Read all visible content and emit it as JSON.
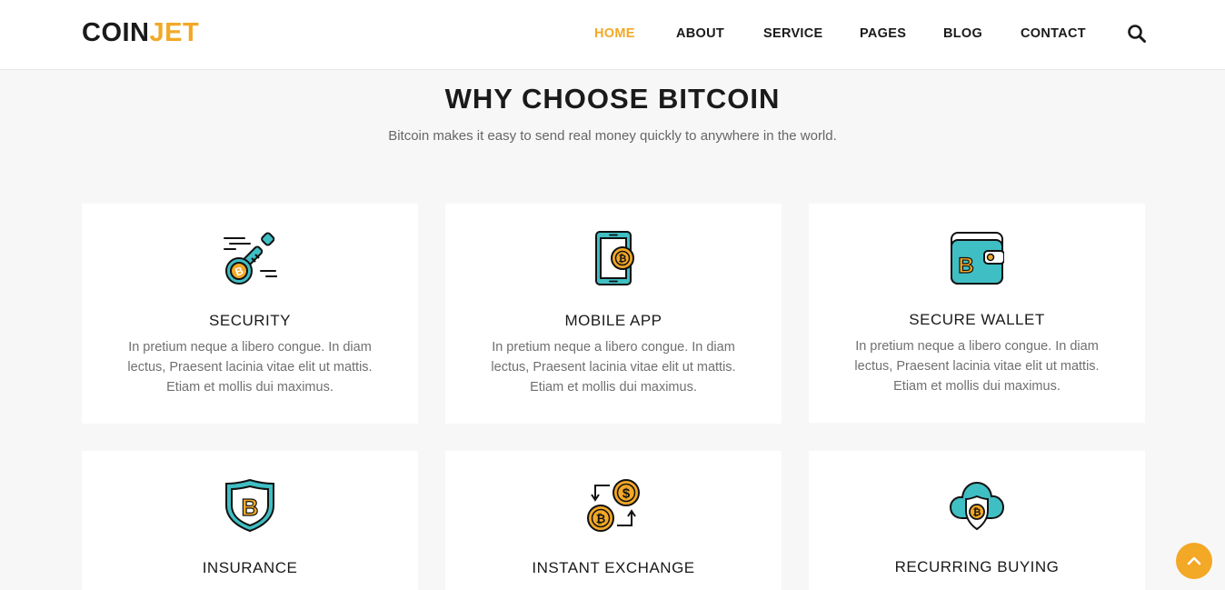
{
  "brand": {
    "part1": "COIN",
    "part2": "JET"
  },
  "nav": [
    {
      "label": "HOME",
      "active": true
    },
    {
      "label": "ABOUT"
    },
    {
      "label": "SERVICE"
    },
    {
      "label": "PAGES"
    },
    {
      "label": "BLOG"
    },
    {
      "label": "CONTACT"
    }
  ],
  "section": {
    "title": "WHY CHOOSE BITCOIN",
    "subtitle": "Bitcoin makes it easy to send real money quickly to anywhere in the world."
  },
  "features": [
    {
      "title": "SECURITY",
      "icon": "bitcoin-key-icon",
      "desc": "In pretium neque a libero congue. In diam lectus, Praesent lacinia vitae elit ut mattis. Etiam et mollis dui maximus."
    },
    {
      "title": "MOBILE APP",
      "icon": "bitcoin-phone-icon",
      "desc": "In pretium neque a libero congue. In diam lectus, Praesent lacinia vitae elit ut mattis. Etiam et mollis dui maximus."
    },
    {
      "title": "SECURE WALLET",
      "icon": "bitcoin-wallet-icon",
      "desc": "In pretium neque a libero congue. In diam lectus, Praesent lacinia vitae elit ut mattis. Etiam et mollis dui maximus."
    },
    {
      "title": "INSURANCE",
      "icon": "bitcoin-shield-icon"
    },
    {
      "title": "INSTANT EXCHANGE",
      "icon": "currency-exchange-icon"
    },
    {
      "title": "RECURRING BUYING",
      "icon": "bitcoin-cloud-icon"
    }
  ],
  "colors": {
    "accent": "#f3a826",
    "teal": "#3fbfc4",
    "background": "#f7f7f7"
  }
}
